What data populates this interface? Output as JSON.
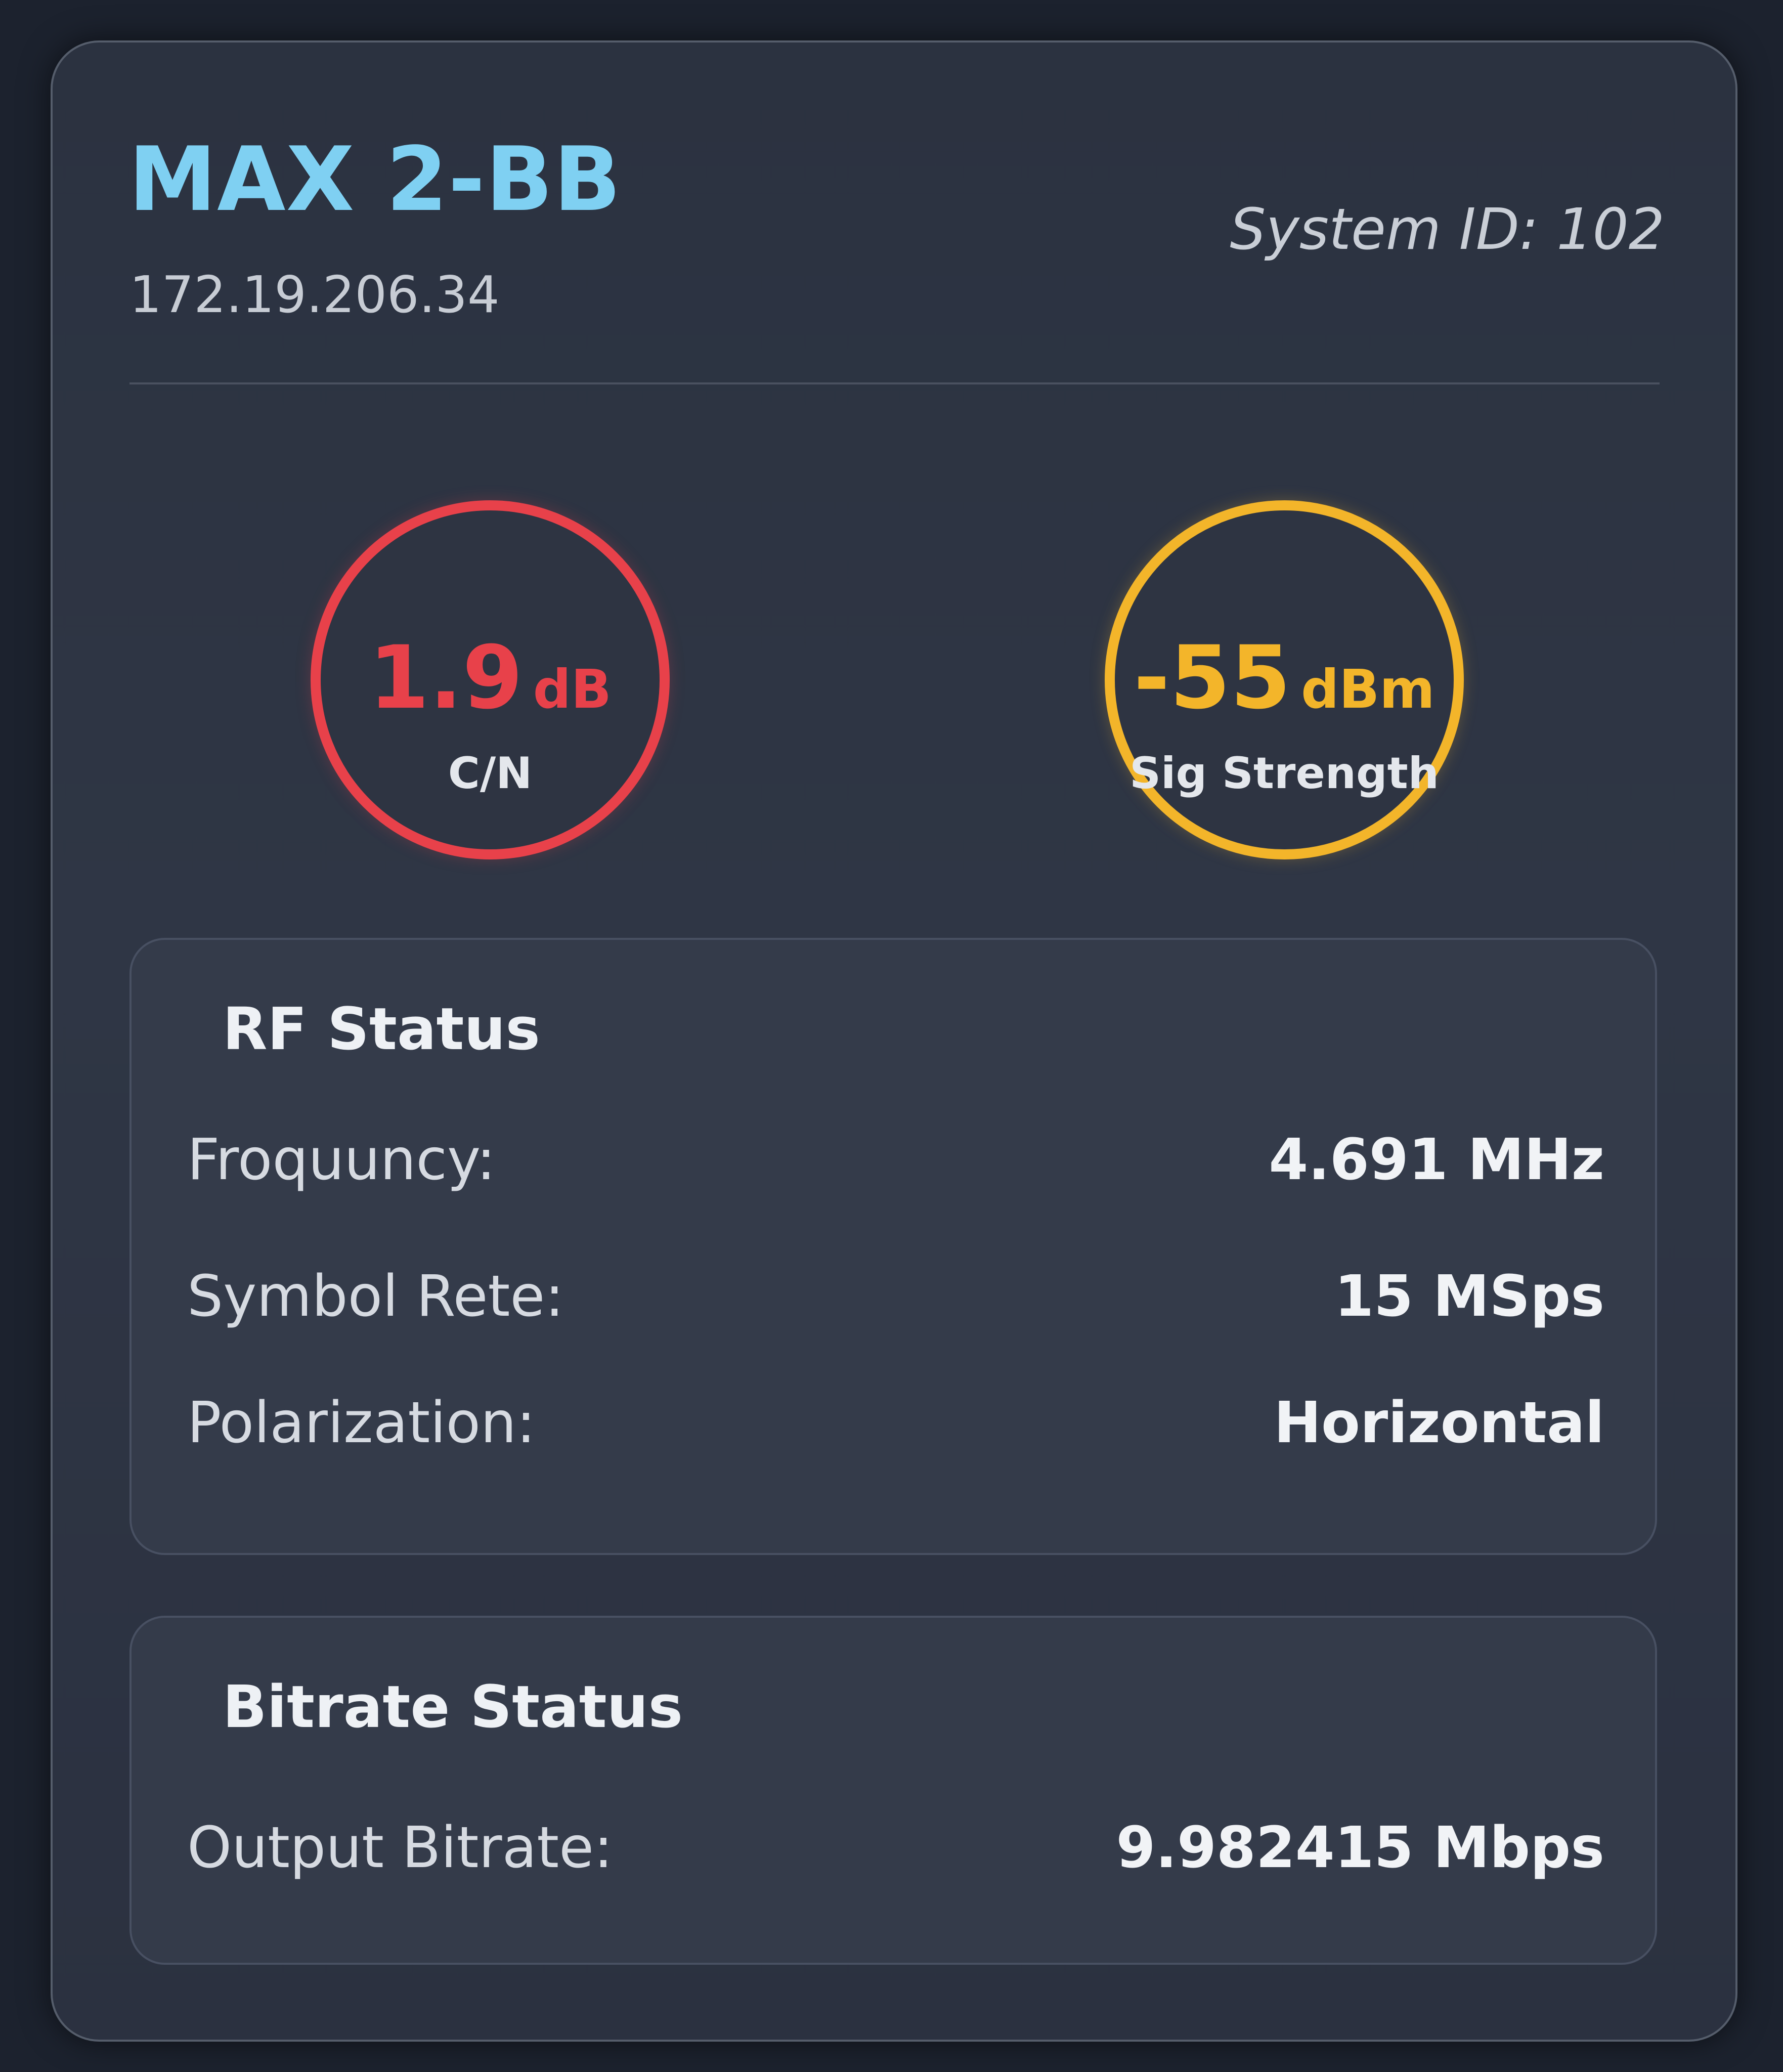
{
  "device": {
    "name": "MAX 2-BB",
    "ip": "172.19.206.34",
    "system_id": "System ID: 102"
  },
  "gauges": {
    "cn": {
      "value": "1.9",
      "unit": "dB",
      "label": "C/N",
      "color": "#e8414a"
    },
    "signal": {
      "value": "-55",
      "unit": "dBm",
      "label": "Sig Strength",
      "color": "#f3b52a"
    }
  },
  "rf_status": {
    "heading": "RF Status",
    "rows": [
      {
        "label": "Froquuncy:",
        "value": "4.691 MHz"
      },
      {
        "label": "Symbol Rete:",
        "value": "15 MSps"
      },
      {
        "label": "Polarization:",
        "value": "Horizontal"
      }
    ]
  },
  "bitrate_status": {
    "heading": "Bitrate Status",
    "rows": [
      {
        "label": "Output Bitrate:",
        "value": "9.982415 Mbps"
      }
    ]
  },
  "colors": {
    "accent_title": "#7fd0f2",
    "cn_ring": "#e8414a",
    "signal_ring": "#f3b52a"
  }
}
